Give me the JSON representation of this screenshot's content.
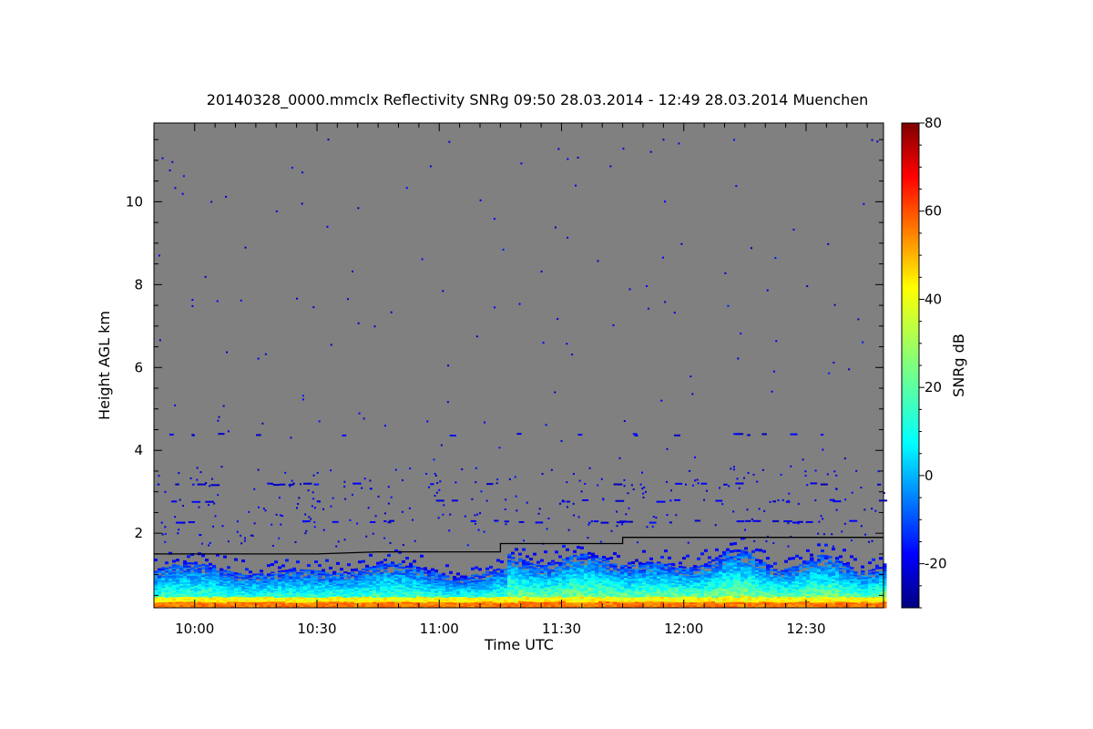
{
  "chart_data": {
    "type": "heatmap",
    "title": "20140328_0000.mmclx Reflectivity SNRg   09:50 28.03.2014 - 12:49 28.03.2014 Muenchen",
    "xlabel": "Time UTC",
    "ylabel": "Height AGL km",
    "colorbar_label": "SNRg dB",
    "xlim": [
      "09:50",
      "12:49"
    ],
    "ylim": [
      0.2,
      11.9
    ],
    "x_ticks": [
      "10:00",
      "10:30",
      "11:00",
      "11:30",
      "12:00",
      "12:30"
    ],
    "y_ticks": [
      2,
      4,
      6,
      8,
      10
    ],
    "colorbar_range": [
      -30,
      80
    ],
    "colorbar_ticks": [
      -20,
      0,
      20,
      40,
      60,
      80
    ],
    "colormap": "jet",
    "background_color": "#808080",
    "boundary_line": {
      "color": "#000000",
      "points": [
        [
          "09:50",
          1.5
        ],
        [
          "10:30",
          1.5
        ],
        [
          "10:45",
          1.55
        ],
        [
          "11:15",
          1.55
        ],
        [
          "11:15",
          1.75
        ],
        [
          "11:45",
          1.75
        ],
        [
          "11:45",
          1.9
        ],
        [
          "12:49",
          1.9
        ]
      ]
    },
    "echo_layers": [
      {
        "description": "surface clutter, strongest returns",
        "height_range_km": [
          0.2,
          0.4
        ],
        "snr_db": 50
      },
      {
        "description": "boundary layer echoes",
        "height_range_km": [
          0.4,
          1.0
        ],
        "snr_db": 20
      },
      {
        "description": "upper boundary layer echoes",
        "height_range_km": [
          1.0,
          1.7
        ],
        "snr_db": 0
      },
      {
        "description": "sparse layer near 3.2 km",
        "height_range_km": [
          3.1,
          3.2
        ],
        "snr_db": -20
      }
    ]
  }
}
